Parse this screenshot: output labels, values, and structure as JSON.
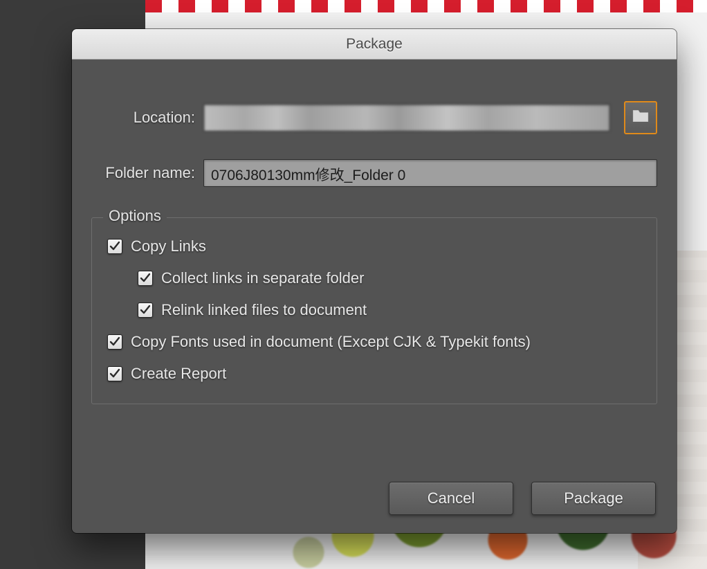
{
  "dialog": {
    "title": "Package",
    "location_label": "Location:",
    "location_value": "",
    "folder_label": "Folder name:",
    "folder_value": "0706J80130mm修改_Folder 0",
    "options_legend": "Options",
    "options": {
      "copy_links": {
        "label": "Copy Links",
        "checked": true
      },
      "collect_links": {
        "label": "Collect links in separate folder",
        "checked": true
      },
      "relink": {
        "label": "Relink linked files to document",
        "checked": true
      },
      "copy_fonts": {
        "label": "Copy Fonts used in document (Except CJK & Typekit fonts)",
        "checked": true
      },
      "create_report": {
        "label": "Create Report",
        "checked": true
      }
    },
    "buttons": {
      "cancel": "Cancel",
      "package": "Package"
    }
  }
}
